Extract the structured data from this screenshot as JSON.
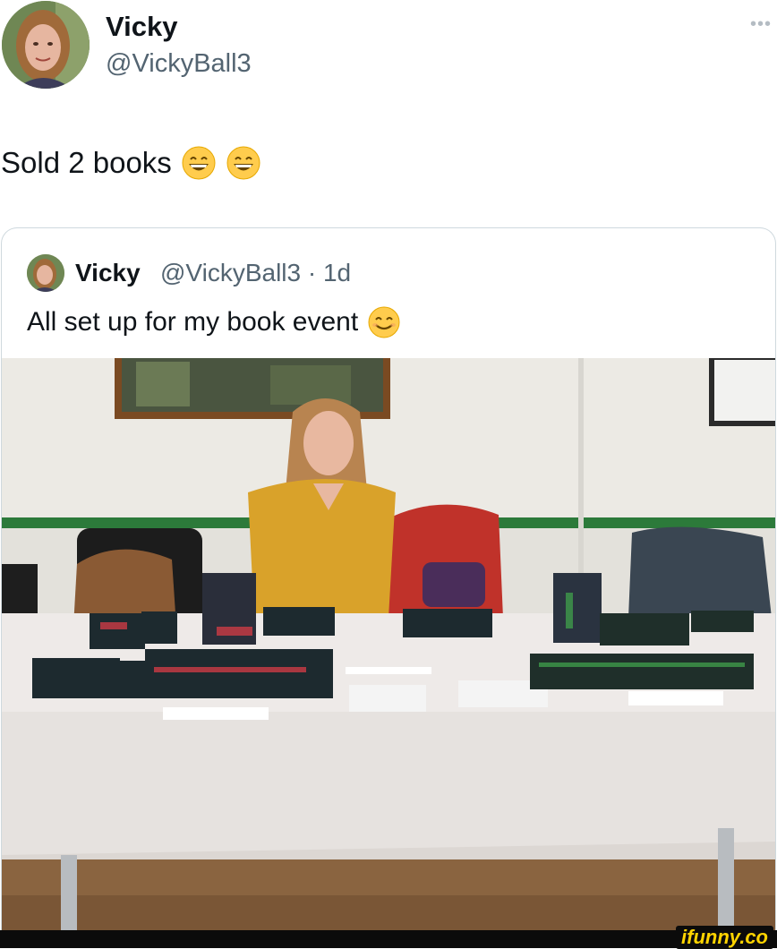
{
  "post": {
    "author": {
      "display_name": "Vicky",
      "handle": "@VickyBall3"
    },
    "text": "Sold 2 books",
    "emojis": [
      "grinning-face-icon",
      "grinning-face-icon"
    ],
    "more_icon": "more-horizontal-icon"
  },
  "quoted_post": {
    "author": {
      "display_name": "Vicky",
      "handle": "@VickyBall3"
    },
    "meta": "@VickyBall3 · 1d",
    "text": "All set up for my book event",
    "emoji": "smiling-face-icon",
    "image_description_icon": "book-event-photo"
  },
  "watermark": {
    "text": "ifunny.co",
    "color": "#ffd400"
  },
  "colors": {
    "secondary_text": "#536471",
    "card_border": "#cfd9de",
    "tablecloth": "#eeeae8",
    "sweater": "#d9a22a"
  }
}
